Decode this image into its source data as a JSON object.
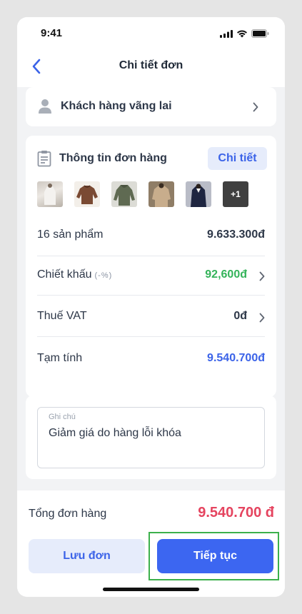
{
  "status_bar": {
    "time": "9:41"
  },
  "nav": {
    "title": "Chi tiết đơn",
    "back_icon": "chevron-left-icon"
  },
  "customer": {
    "name": "Khách hàng vãng lai"
  },
  "order_info": {
    "title": "Thông tin đơn hàng",
    "detail_label": "Chi tiết",
    "thumbnails": [
      "white-dress-photo",
      "brown-sweater-photo",
      "green-hoodie-photo",
      "beige-sweater-photo",
      "navy-outfit-photo"
    ],
    "more_label": "+1",
    "rows": [
      {
        "label": "16 sản phẩm",
        "sub": "",
        "value": "9.633.300đ"
      },
      {
        "label": "Chiết khấu",
        "sub": "(-%)",
        "value": "92,600đ"
      },
      {
        "label": "Thuế VAT",
        "sub": "",
        "value": "0đ"
      },
      {
        "label": "Tạm tính",
        "sub": "",
        "value": "9.540.700đ"
      }
    ]
  },
  "note": {
    "label": "Ghi chú",
    "value": "Giảm giá do hàng lỗi khóa"
  },
  "footer": {
    "total_label": "Tổng đơn hàng",
    "total_value": "9.540.700 đ",
    "save_label": "Lưu đơn",
    "continue_label": "Tiếp tục"
  },
  "colors": {
    "accent": "#3c66f1",
    "discount": "#34b35a",
    "subtotal": "#3b63e8",
    "total": "#e5445f",
    "highlight": "#3cb04c"
  }
}
